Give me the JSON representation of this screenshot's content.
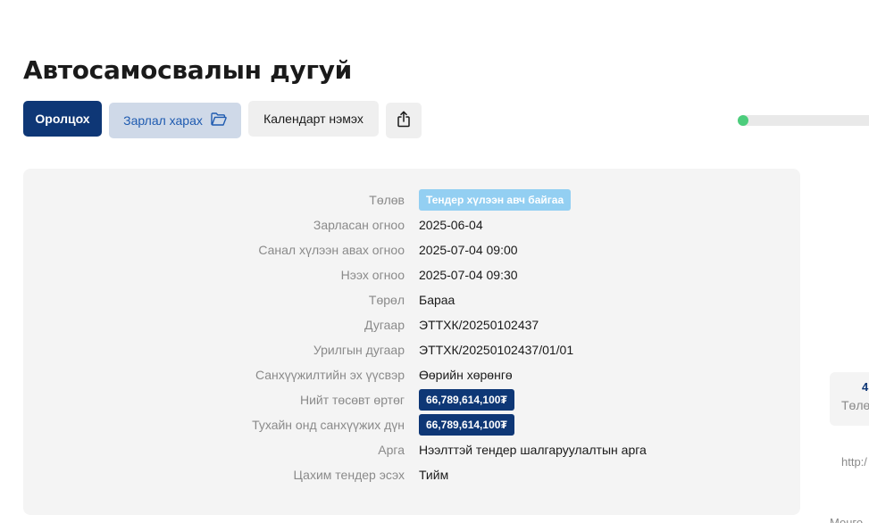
{
  "page": {
    "title": "Автосамосвалын дугуй"
  },
  "toolbar": {
    "participate_label": "Оролцох",
    "view_notice_label": "Зарлал харах",
    "add_calendar_label": "Календарт нэмэх"
  },
  "progress": {
    "value_fraction": 0.03,
    "color": "#4ccd7c"
  },
  "details": {
    "rows": [
      {
        "label": "Төлөв",
        "value": "Тендер хүлээн авч байгаа",
        "kind": "badge-light"
      },
      {
        "label": "Зарласан огноо",
        "value": "2025-06-04",
        "kind": "text"
      },
      {
        "label": "Санал хүлээн авах огноо",
        "value": "2025-07-04 09:00",
        "kind": "text"
      },
      {
        "label": "Нээх огноо",
        "value": "2025-07-04 09:30",
        "kind": "text"
      },
      {
        "label": "Төрөл",
        "value": "Бараа",
        "kind": "text"
      },
      {
        "label": "Дугаар",
        "value": "ЭТТХК/20250102437",
        "kind": "text"
      },
      {
        "label": "Урилгын дугаар",
        "value": "ЭТТХК/20250102437/01/01",
        "kind": "text"
      },
      {
        "label": "Санхүүжилтийн эх үүсвэр",
        "value": "Өөрийн хөрөнгө",
        "kind": "text"
      },
      {
        "label": "Нийт төсөвт өртөг",
        "value": "66,789,614,100₮",
        "kind": "badge-dark"
      },
      {
        "label": "Тухайн онд санхүүжих дүн",
        "value": "66,789,614,100₮",
        "kind": "badge-dark"
      },
      {
        "label": "Арга",
        "value": "Нээлттэй тендер шалгаруулалтын арга",
        "kind": "text"
      },
      {
        "label": "Цахим тендер эсэх",
        "value": "Тийм",
        "kind": "text"
      }
    ]
  },
  "side": {
    "stat_number": "4",
    "stat_label": "Төлө",
    "link_text": "http:/",
    "bottom_text": "Монго"
  },
  "colors": {
    "primary": "#0e3776",
    "secondary_bg": "#cfd9e8",
    "secondary_text": "#1f5bb0",
    "status_badge": "#93cff2"
  },
  "icons": {
    "view_notice": "folder-open-icon",
    "share": "share-icon"
  }
}
